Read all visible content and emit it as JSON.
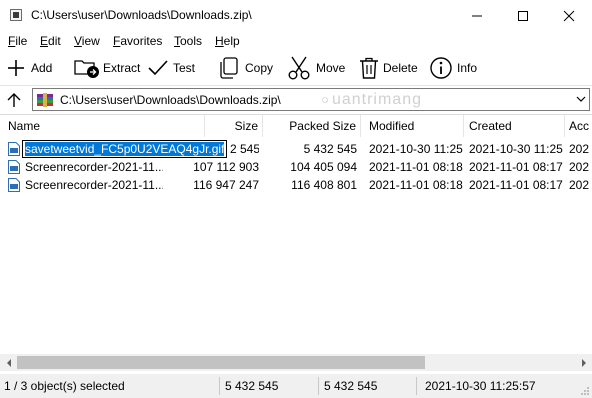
{
  "window": {
    "title": "C:\\Users\\user\\Downloads\\Downloads.zip\\",
    "icon": "archive-icon"
  },
  "menu": [
    {
      "key": "F",
      "rest": "ile"
    },
    {
      "key": "E",
      "rest": "dit"
    },
    {
      "key": "V",
      "rest": "iew"
    },
    {
      "key": "F",
      "rest": "avorites",
      "pre": ""
    },
    {
      "key": "T",
      "rest": "ools"
    },
    {
      "key": "H",
      "rest": "elp"
    }
  ],
  "toolbar": {
    "add": "Add",
    "extract": "Extract",
    "test": "Test",
    "copy": "Copy",
    "move": "Move",
    "delete": "Delete",
    "info": "Info"
  },
  "address": {
    "path": "C:\\Users\\user\\Downloads\\Downloads.zip\\"
  },
  "columns": {
    "name": "Name",
    "size": "Size",
    "packed": "Packed Size",
    "modified": "Modified",
    "created": "Created",
    "accessed": "Acc"
  },
  "files": [
    {
      "name": "savetweetvid_FC5p0U2VEAQ4gJr.gif",
      "size": "2 545",
      "packed": "5 432 545",
      "modified": "2021-10-30 11:25",
      "created": "2021-10-30 11:25",
      "accessed": "202"
    },
    {
      "name": "Screenrecorder-2021-11...",
      "size": "107 112 903",
      "packed": "104 405 094",
      "modified": "2021-11-01 08:18",
      "created": "2021-11-01 08:17",
      "accessed": "202"
    },
    {
      "name": "Screenrecorder-2021-11...",
      "size": "116 947 247",
      "packed": "116 408 801",
      "modified": "2021-11-01 08:18",
      "created": "2021-11-01 08:17",
      "accessed": "202"
    }
  ],
  "status": {
    "selection": "1 / 3 object(s) selected",
    "size": "5 432 545",
    "packed": "5 432 545",
    "modified": "2021-10-30 11:25:57"
  },
  "watermark": "uantrimang",
  "colors": {
    "selection": "#0078d7",
    "status_bg": "#f0f0f0"
  }
}
